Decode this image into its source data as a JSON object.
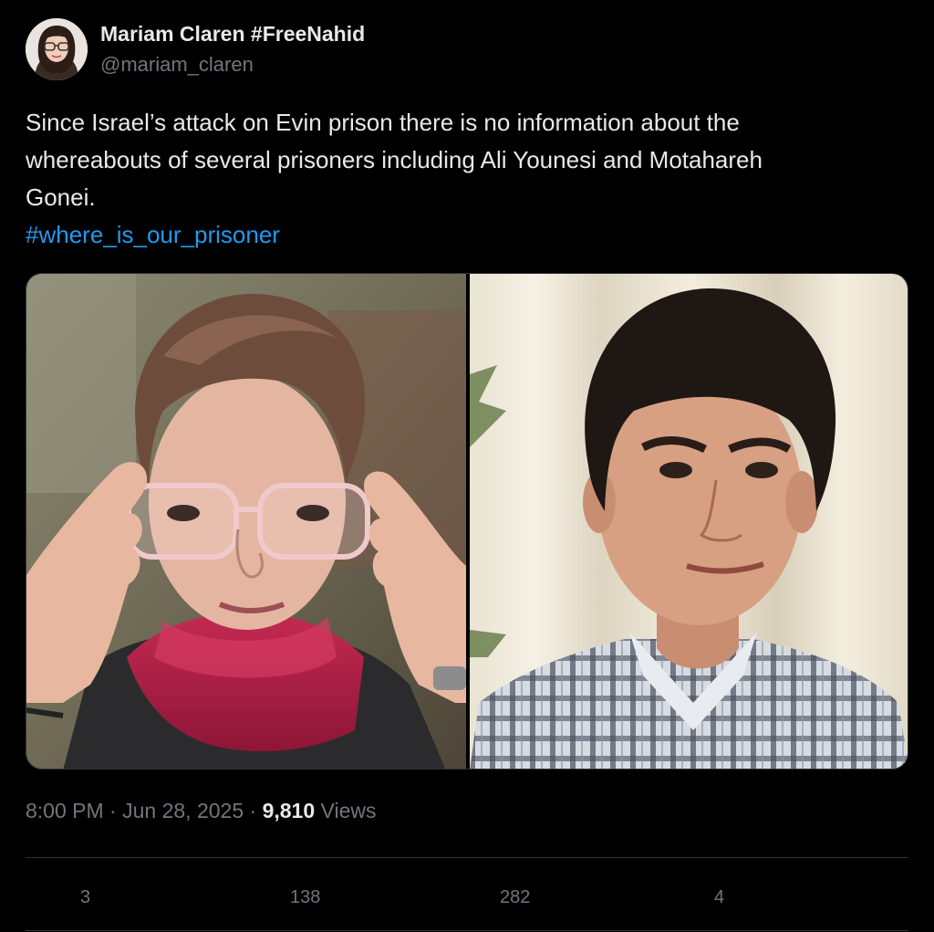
{
  "author": {
    "display_name": "Mariam Claren #FreeNahid",
    "handle": "@mariam_claren",
    "avatar_icon": "profile-photo"
  },
  "tweet": {
    "text_lines": [
      "Since Israel’s attack on Evin prison there is no information about the",
      "whereabouts of several prisoners including Ali Younesi and Motahareh",
      "Gonei."
    ],
    "hashtag": "#where_is_our_prisoner"
  },
  "media": {
    "photos": [
      {
        "description_icon": "woman-portrait-photo"
      },
      {
        "description_icon": "man-portrait-photo"
      }
    ]
  },
  "meta": {
    "time": "8:00 PM",
    "separator": "·",
    "date": "Jun 28, 2025",
    "views_count": "9,810",
    "views_label": "Views"
  },
  "actions": {
    "replies": "3",
    "retweets": "138",
    "likes": "282",
    "bookmarks": "4"
  },
  "colors": {
    "background": "#000000",
    "text": "#e7e9ea",
    "muted": "#71767b",
    "link": "#1d9bf0",
    "border": "#2f3336"
  }
}
